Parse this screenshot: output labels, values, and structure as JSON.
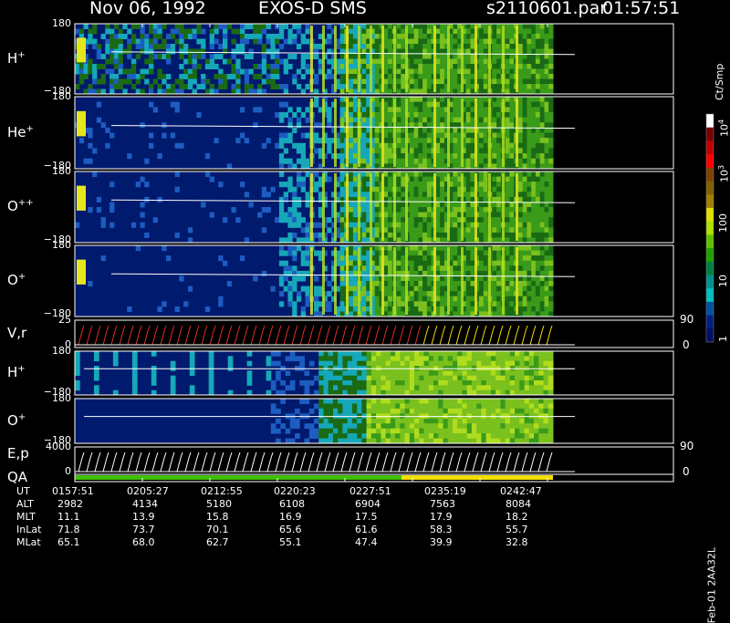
{
  "header": {
    "date": "Nov 06, 1992",
    "instrument": "EXOS-D SMS",
    "file": "s2110601.par",
    "time": "01:57:51"
  },
  "panels": [
    {
      "key": "hplus",
      "label": "H",
      "sup": "+",
      "ymax": "180",
      "ymin": "−180"
    },
    {
      "key": "heplus",
      "label": "He",
      "sup": "+",
      "ymax": "180",
      "ymin": "−180"
    },
    {
      "key": "oplusplus",
      "label": "O",
      "sup": "++",
      "ymax": "180",
      "ymin": "−180"
    },
    {
      "key": "oplus",
      "label": "O",
      "sup": "+",
      "ymax": "180",
      "ymin": "−180"
    },
    {
      "key": "vr",
      "label": "V,r",
      "sup": "",
      "ymax": "25",
      "ymin": "0",
      "rtop": "90",
      "rbot": "0"
    },
    {
      "key": "hplus2",
      "label": "H",
      "sup": "+",
      "ymax": "180",
      "ymin": "−180"
    },
    {
      "key": "oplus2",
      "label": "O",
      "sup": "+",
      "ymax": "180",
      "ymin": "−180"
    },
    {
      "key": "ep",
      "label": "E,p",
      "sup": "",
      "ymax": "4000",
      "ymin": "0",
      "rtop": "90",
      "rbot": "0"
    },
    {
      "key": "qa",
      "label": "QA",
      "sup": ""
    }
  ],
  "colorbar": {
    "unit": "Ct/Smp",
    "ticks": [
      {
        "base": "10",
        "exp": "4"
      },
      {
        "base": "10",
        "exp": "3"
      },
      {
        "base": "100",
        "exp": ""
      },
      {
        "base": "10",
        "exp": ""
      },
      {
        "base": "1",
        "exp": ""
      }
    ],
    "colors": [
      "#ffffff",
      "#7a0000",
      "#c00000",
      "#ff0000",
      "#804000",
      "#806000",
      "#a08000",
      "#e0e000",
      "#b0e000",
      "#60c000",
      "#20a000",
      "#008040",
      "#009090",
      "#00c0c0",
      "#0050a0",
      "#002080",
      "#001060"
    ]
  },
  "time_table": {
    "rows": [
      {
        "label": "UT",
        "values": [
          "0157:51",
          "0205:27",
          "0212:55",
          "0220:23",
          "0227:51",
          "0235:19",
          "0242:47"
        ]
      },
      {
        "label": "ALT",
        "values": [
          "2982",
          "4134",
          "5180",
          "6108",
          "6904",
          "7563",
          "8084"
        ]
      },
      {
        "label": "MLT",
        "values": [
          "11.1",
          "13.9",
          "15.8",
          "16.9",
          "17.5",
          "17.9",
          "18.2"
        ]
      },
      {
        "label": "InLat",
        "values": [
          "71.8",
          "73.7",
          "70.1",
          "65.6",
          "61.6",
          "58.3",
          "55.7"
        ]
      },
      {
        "label": "MLat",
        "values": [
          "65.1",
          "68.0",
          "62.7",
          "55.1",
          "47.4",
          "39.9",
          "32.8"
        ]
      }
    ]
  },
  "side_note": "Feb-01 2AA32L",
  "chart_data": {
    "type": "heatmap",
    "title": "Nov 06, 1992 EXOS-D SMS",
    "xlabel": "UT",
    "x_ticks": [
      "0157:51",
      "0205:27",
      "0212:55",
      "0220:23",
      "0227:51",
      "0235:19",
      "0242:47"
    ],
    "ylabel_panels": [
      "H+",
      "He+",
      "O++",
      "O+",
      "V,r",
      "H+",
      "O+",
      "E,p",
      "QA"
    ],
    "pitch_angle_range": [
      -180,
      180
    ],
    "color_scale": "log",
    "color_unit": "Ct/Smp",
    "color_range": [
      1,
      10000
    ],
    "data_end_time": "0244:30",
    "qa_segments": [
      {
        "from": "0157:51",
        "to": "0231:00",
        "status": "good",
        "color": "#40c000"
      },
      {
        "from": "0231:00",
        "to": "0244:30",
        "status": "caution",
        "color": "#f0e000"
      }
    ]
  }
}
